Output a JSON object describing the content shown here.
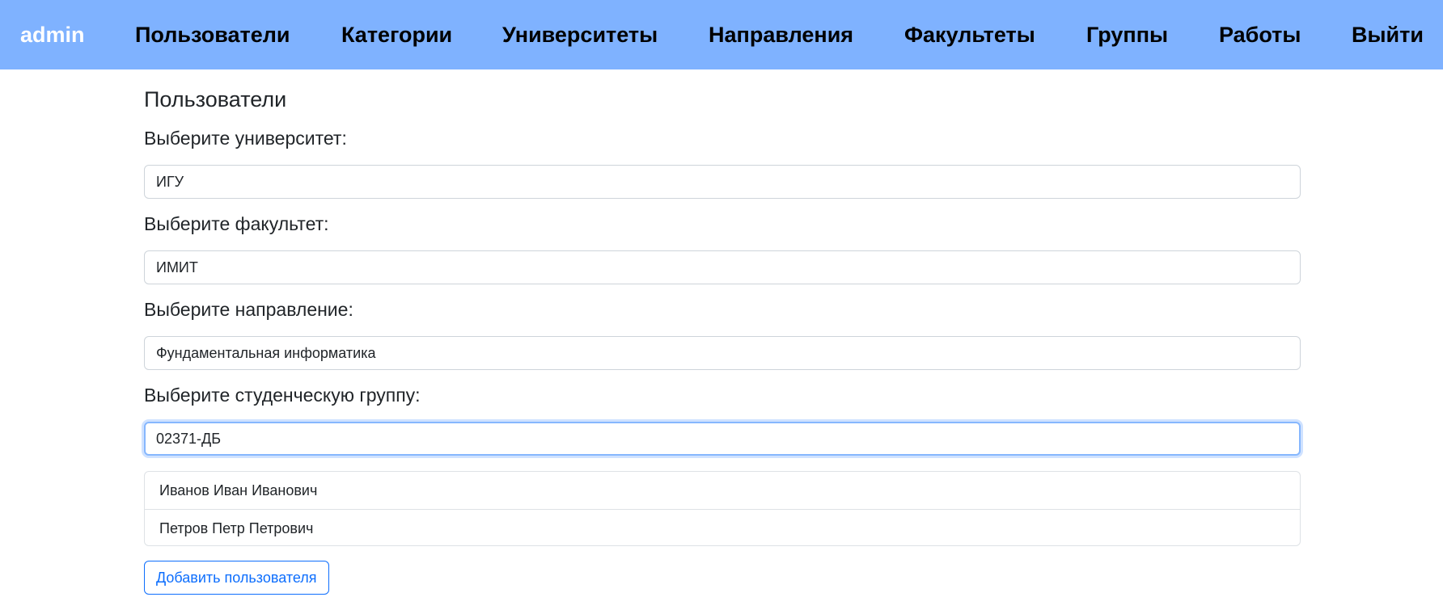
{
  "navbar": {
    "brand": "admin",
    "items": [
      {
        "label": "Пользователи"
      },
      {
        "label": "Категории"
      },
      {
        "label": "Университеты"
      },
      {
        "label": "Направления"
      },
      {
        "label": "Факультеты"
      },
      {
        "label": "Группы"
      },
      {
        "label": "Работы"
      },
      {
        "label": "Выйти"
      }
    ],
    "background_color": "#7fb2ff"
  },
  "main": {
    "title": "Пользователи",
    "fields": [
      {
        "label": "Выберите университет:",
        "value": "ИГУ"
      },
      {
        "label": "Выберите факультет:",
        "value": "ИМИТ"
      },
      {
        "label": "Выберите направление:",
        "value": "Фундаментальная информатика"
      },
      {
        "label": "Выберите студенческую группу:",
        "value": "02371-ДБ"
      }
    ],
    "users": [
      {
        "name": "Иванов Иван Иванович"
      },
      {
        "name": "Петров Петр Петрович"
      }
    ],
    "add_button": "Добавить пользователя",
    "accent_color": "#0d6efd"
  }
}
